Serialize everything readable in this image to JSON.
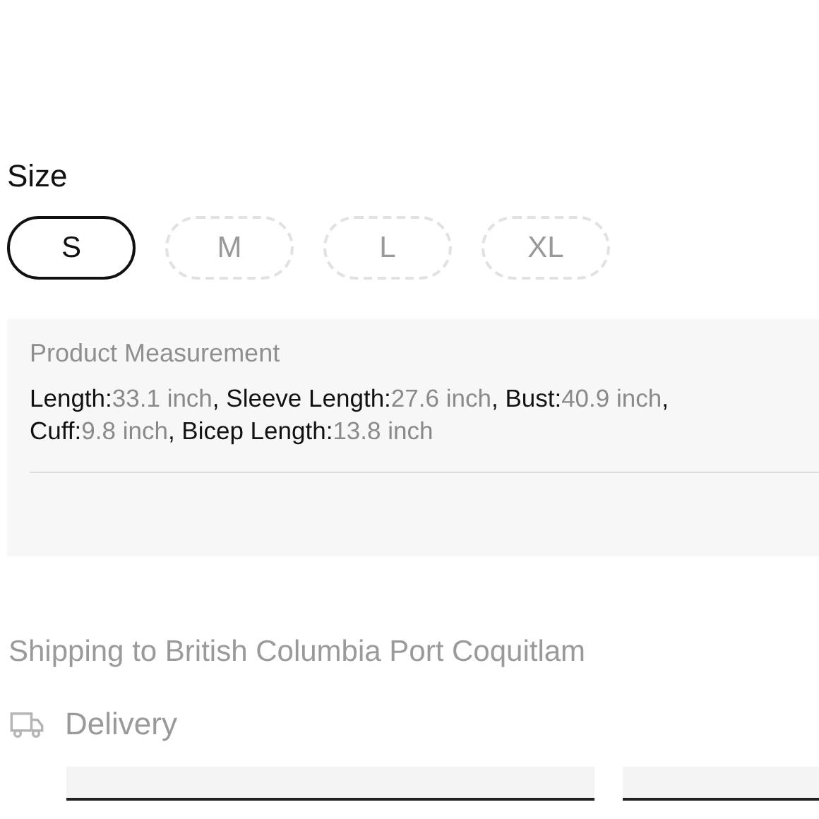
{
  "size_selector": {
    "label": "Size",
    "options": [
      {
        "label": "S",
        "selected": true
      },
      {
        "label": "M",
        "selected": false
      },
      {
        "label": "L",
        "selected": false
      },
      {
        "label": "XL",
        "selected": false
      }
    ]
  },
  "measurement": {
    "title": "Product Measurement",
    "items": [
      {
        "label": "Length:",
        "value": "33.1 inch",
        "sep": ", "
      },
      {
        "label": "Sleeve Length:",
        "value": "27.6 inch",
        "sep": ", "
      },
      {
        "label": "Bust:",
        "value": "40.9 inch",
        "sep": ","
      },
      {
        "label": "Cuff:",
        "value": "9.8 inch",
        "sep": ", "
      },
      {
        "label": "Bicep Length:",
        "value": "13.8 inch"
      }
    ]
  },
  "shipping": {
    "destination": "Shipping to British Columbia Port Coquitlam",
    "method": "Delivery"
  }
}
